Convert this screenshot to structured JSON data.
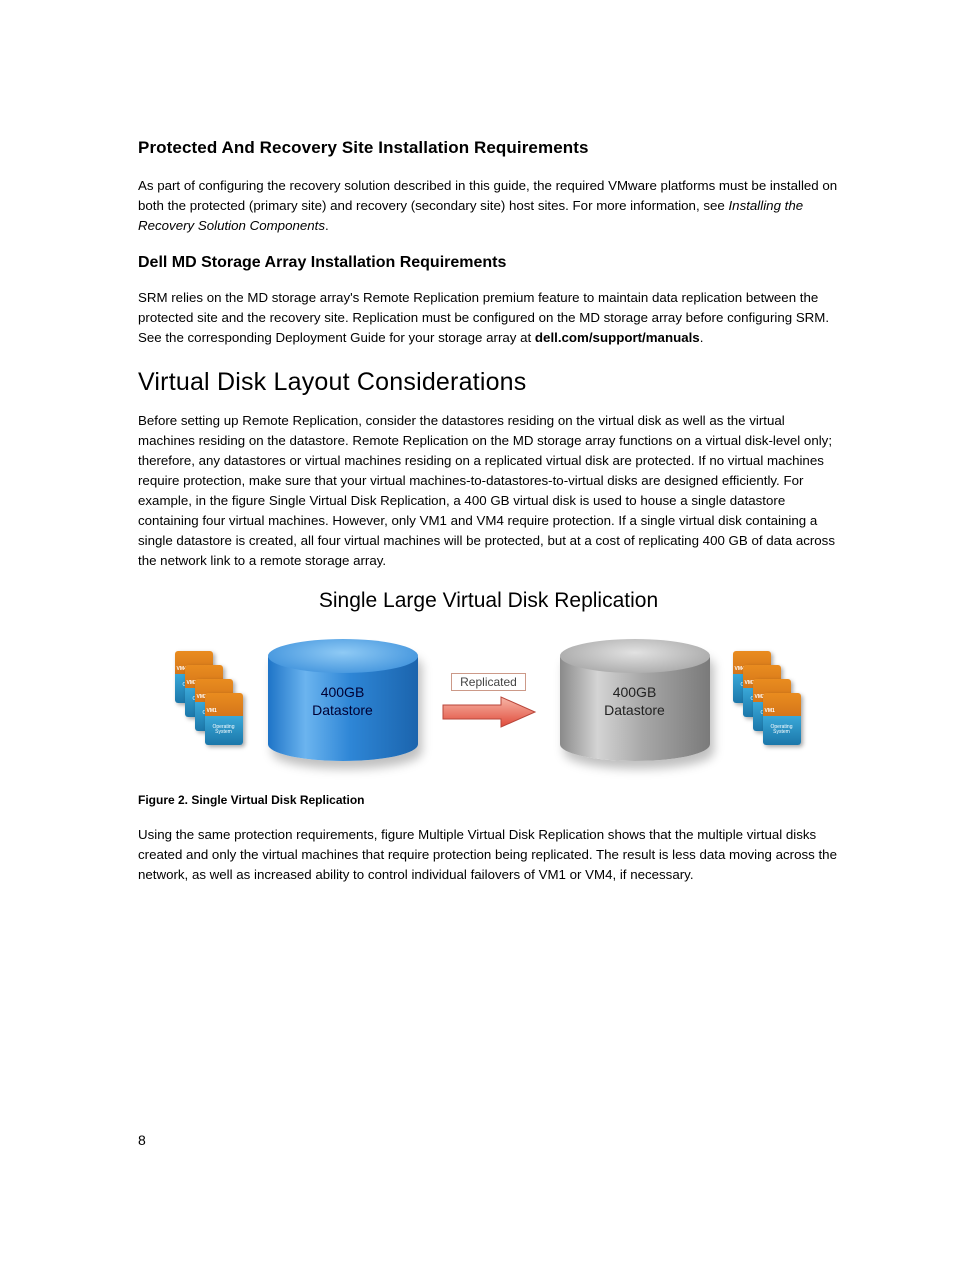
{
  "h1": "Protected And Recovery Site Installation Requirements",
  "p1a": "As part of configuring the recovery solution described in this guide, the required VMware platforms must be installed on both the protected (primary site) and recovery (secondary site) host sites. For more information, see ",
  "p1b": "Installing the Recovery Solution Components",
  "p1c": ".",
  "h2": "Dell MD Storage Array Installation Requirements",
  "p2a": "SRM relies on the MD storage array's Remote Replication premium feature to maintain data replication between the protected site and the recovery site. Replication must be configured on the MD storage array before configuring SRM. See the corresponding Deployment Guide for your storage array at ",
  "p2b": "dell.com/support/manuals",
  "p2c": ".",
  "h3": "Virtual Disk Layout Considerations",
  "p3": "Before setting up Remote Replication, consider the datastores residing on the virtual disk as well as the virtual machines residing on the datastore. Remote Replication on the MD storage array functions on a virtual disk-level only; therefore, any datastores or virtual machines residing on a replicated virtual disk are protected. If no virtual machines require protection, make sure that your virtual machines-to-datastores-to-virtual disks are designed efficiently. For example, in the figure Single Virtual Disk Replication, a 400 GB virtual disk is used to house a single datastore containing four virtual machines. However, only VM1 and VM4 require protection. If a single virtual disk containing a single datastore is created, all four virtual machines will be protected, but at a cost of replicating 400 GB of data across the network link to a remote storage array.",
  "figure": {
    "title": "Single Large Virtual Disk Replication",
    "left_vms": [
      "VM4",
      "VM3",
      "VM2",
      "VM1"
    ],
    "right_vms": [
      "VM4",
      "VM3",
      "VM2",
      "VM1"
    ],
    "vm_sub": "Operating System",
    "cyl_text1": "400GB",
    "cyl_text2": "Datastore",
    "arrow_label": "Replicated",
    "caption": "Figure 2. Single Virtual Disk Replication"
  },
  "p4": "Using the same protection requirements, figure Multiple Virtual Disk Replication shows that the multiple virtual disks created and only the virtual machines that require protection being replicated. The result is less data moving across the network, as well as increased ability to control individual failovers of VM1 or VM4, if necessary.",
  "page_number": "8"
}
